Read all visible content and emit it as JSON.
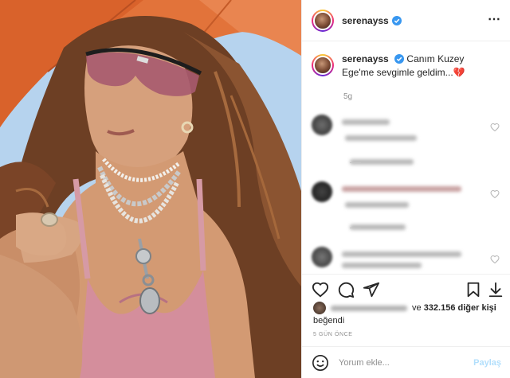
{
  "post": {
    "username": "serenayss",
    "caption_user": "serenayss",
    "caption_text": "Canım Kuzey Ege'me sevgimle geldim...",
    "caption_emoji": "💔",
    "time_ago": "5g"
  },
  "likes": {
    "prefix": "ve",
    "count": "332.156",
    "suffix": "diğer kişi",
    "liked_label": "beğendi"
  },
  "date_label": "5 GÜN ÖNCE",
  "comment_box": {
    "placeholder": "Yorum ekle...",
    "share_label": "Paylaş"
  },
  "icons": {
    "verified": "verified-badge-icon",
    "more": "more-options-icon",
    "like": "heart-icon",
    "comment": "comment-icon",
    "share": "paper-plane-icon",
    "save": "bookmark-icon",
    "download": "download-icon",
    "emoji": "smiley-icon"
  },
  "colors": {
    "verified_blue": "#3897f0",
    "text": "#262626",
    "muted": "#8e8e8e",
    "share_disabled": "#b2dffc",
    "heart_red": "#e0245e"
  }
}
